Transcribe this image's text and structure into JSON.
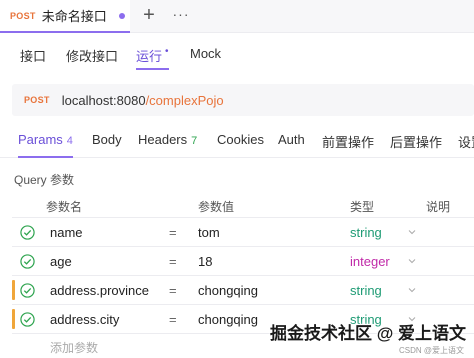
{
  "request_tab": {
    "method": "POST",
    "title": "未命名接口"
  },
  "mode_tabs": [
    {
      "label": "接口"
    },
    {
      "label": "修改接口"
    },
    {
      "label": "运行",
      "dot": "•"
    },
    {
      "label": "Mock"
    }
  ],
  "url_bar": {
    "method": "POST",
    "host": "localhost:8080",
    "path": "/complexPojo"
  },
  "param_tabs": [
    {
      "label": "Params",
      "count": "4"
    },
    {
      "label": "Body"
    },
    {
      "label": "Headers",
      "count": "7"
    },
    {
      "label": "Cookies"
    },
    {
      "label": "Auth"
    },
    {
      "label": "前置操作"
    },
    {
      "label": "后置操作"
    },
    {
      "label": "设置"
    }
  ],
  "query_section_label": "Query 参数",
  "table": {
    "headers": {
      "name": "参数名",
      "value": "参数值",
      "type": "类型",
      "desc": "说明"
    },
    "rows": [
      {
        "name": "name",
        "eq": "=",
        "value": "tom",
        "type": "string"
      },
      {
        "name": "age",
        "eq": "=",
        "value": "18",
        "type": "integer"
      },
      {
        "name": "address.province",
        "eq": "=",
        "value": "chongqing",
        "type": "string"
      },
      {
        "name": "address.city",
        "eq": "=",
        "value": "chongqing",
        "type": "string"
      }
    ],
    "add_placeholder": "添加参数"
  },
  "watermark": "掘金技术社区 @ 爱上语文",
  "watermark_sub": "CSDN @爱上语文",
  "colors": {
    "accent": "#8c6dee",
    "post": "#e8743b",
    "string": "#1e9b74",
    "integer": "#c02aa8",
    "check": "#2ea44f"
  }
}
